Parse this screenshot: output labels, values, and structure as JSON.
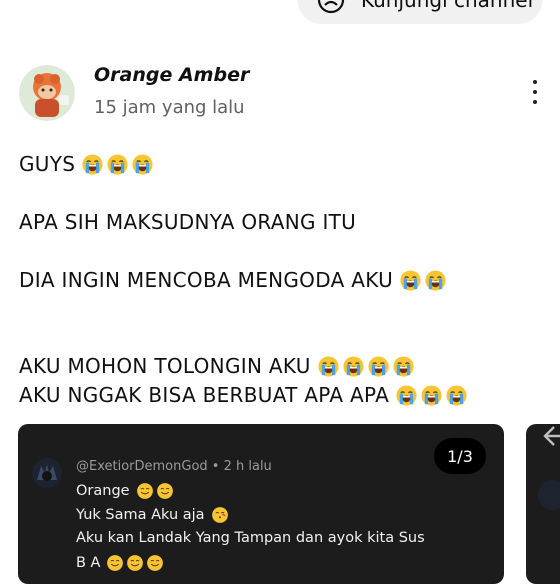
{
  "header": {
    "visit_button_label": "Kunjungi channel"
  },
  "post": {
    "author": "Orange Amber",
    "timestamp": "15 jam yang lalu",
    "lines": [
      {
        "text": "GUYS",
        "emoji_count": 3
      },
      {
        "text": "APA SIH MAKSUDNYA ORANG ITU",
        "emoji_count": 0
      },
      {
        "text": "DIA INGIN MENCOBA MENGODA AKU",
        "emoji_count": 2
      },
      {
        "text": "AKU MOHON TOLONGIN AKU",
        "emoji_count": 4
      },
      {
        "text": "AKU NGGAK BISA BERBUAT APA APA",
        "emoji_count": 3
      }
    ]
  },
  "image_card": {
    "counter": "1/3",
    "comment_handle": "@ExetiorDemonGod • 2 h lalu",
    "comment_lines": [
      "Orange",
      "Yuk Sama Aku aja",
      "Aku kan Landak Yang Tampan dan ayok kita Sus",
      "B      A"
    ]
  },
  "icons": {
    "visit": "user-frown-icon",
    "menu": "more-vertical-icon",
    "emoji": "loudly-crying-face-emoji",
    "back": "arrow-left-icon"
  }
}
